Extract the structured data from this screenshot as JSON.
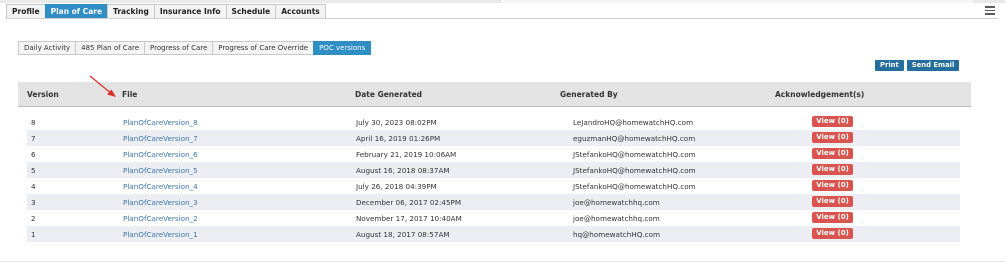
{
  "main_tabs": [
    "Profile",
    "Plan of Care",
    "Tracking",
    "Insurance Info",
    "Schedule",
    "Accounts"
  ],
  "main_active": 1,
  "sub_tabs": [
    "Daily Activity",
    "485 Plan of Care",
    "Progress of Care",
    "Progress of Care Override",
    "POC versions"
  ],
  "sub_active": 4,
  "actions": {
    "print": "Print",
    "send_email": "Send Email"
  },
  "table": {
    "headers": {
      "version": "Version",
      "file": "File",
      "date_generated": "Date Generated",
      "generated_by": "Generated By",
      "acknowledgements": "Acknowledgement(s)"
    },
    "rows": [
      {
        "version": "8",
        "file": "PlanOfCareVersion_8",
        "date": "July 30, 2023 08:02PM",
        "by": "LeJandroHQ@homewatchHQ.com",
        "ack": "View (0)"
      },
      {
        "version": "7",
        "file": "PlanOfCareVersion_7",
        "date": "April 16, 2019 01:26PM",
        "by": "eguzmanHQ@homewatchHQ.com",
        "ack": "View (0)"
      },
      {
        "version": "6",
        "file": "PlanOfCareVersion_6",
        "date": "February 21, 2019 10:06AM",
        "by": "JStefankoHQ@homewatchHQ.com",
        "ack": "View (0)"
      },
      {
        "version": "5",
        "file": "PlanOfCareVersion_5",
        "date": "August 16, 2018 08:37AM",
        "by": "JStefankoHQ@homewatchHQ.com",
        "ack": "View (0)"
      },
      {
        "version": "4",
        "file": "PlanOfCareVersion_4",
        "date": "July 26, 2018 04:39PM",
        "by": "JStefankoHQ@homewatchHQ.com",
        "ack": "View (0)"
      },
      {
        "version": "3",
        "file": "PlanOfCareVersion_3",
        "date": "December 06, 2017 02:45PM",
        "by": "joe@homewatchhq.com",
        "ack": "View (0)"
      },
      {
        "version": "2",
        "file": "PlanOfCareVersion_2",
        "date": "November 17, 2017 10:40AM",
        "by": "joe@homewatchhq.com",
        "ack": "View (0)"
      },
      {
        "version": "1",
        "file": "PlanOfCareVersion_1",
        "date": "August 18, 2017 08:57AM",
        "by": "hq@homewatchHQ.com",
        "ack": "View (0)"
      }
    ]
  },
  "colors": {
    "tab_active": "#2f8ec4",
    "action_button": "#236e9c",
    "view_button": "#d9534f",
    "link": "#3e78aa",
    "row_alt": "#eceef3",
    "header_bg": "#e3e3e3",
    "annotation_arrow": "#d9302c"
  },
  "icons": {
    "menu": "hamburger-menu-icon",
    "annotation": "red-arrow-icon"
  }
}
